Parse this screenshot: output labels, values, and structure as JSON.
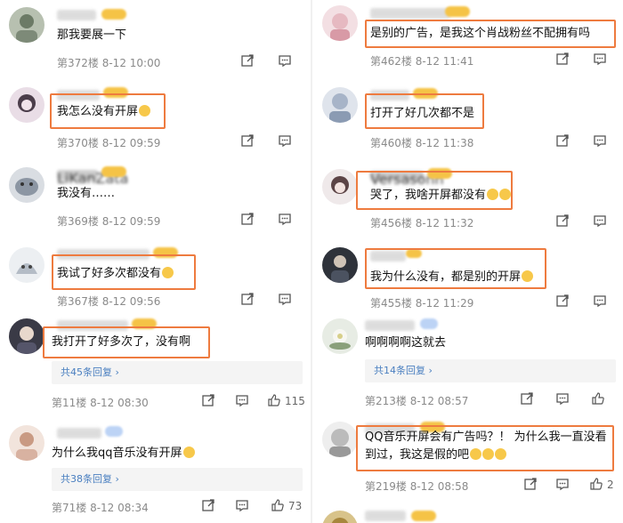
{
  "left": [
    {
      "text": "那我要展一下",
      "meta": "第372楼  8-12 10:00"
    },
    {
      "text": "我怎么没有开屏",
      "meta": "第370楼  8-12 09:59"
    },
    {
      "text": "我没有……",
      "meta": "第369楼  8-12 09:59",
      "name": "LiKanZata"
    },
    {
      "text": "我试了好多次都没有",
      "meta": "第367楼  8-12 09:56"
    },
    {
      "text": "我打开了好多次了，没有啊",
      "reply": "共45条回复 ›",
      "meta": "第11楼  8-12 08:30",
      "likes": "115"
    },
    {
      "text": "为什么我qq音乐没有开屏",
      "reply": "共38条回复 ›",
      "meta": "第71楼  8-12 08:34",
      "likes": "73"
    }
  ],
  "right": [
    {
      "text": "是别的广告，是我这个肖战粉丝不配拥有吗",
      "meta": "第462楼  8-12 11:41"
    },
    {
      "text": "打开了好几次都不是",
      "meta": "第460楼  8-12 11:38"
    },
    {
      "text": "哭了，我啥开屏都没有",
      "meta": "第456楼  8-12 11:32",
      "name": "Versasonn"
    },
    {
      "text": "我为什么没有，都是别的开屏",
      "meta": "第455楼  8-12 11:29"
    },
    {
      "text": "啊啊啊啊这就去",
      "reply": "共14条回复 ›",
      "meta": "第213楼  8-12 08:57"
    },
    {
      "text": "QQ音乐开屏会有广告吗？！ 为什么我一直没看到过，我这是假的吧",
      "meta": "第219楼  8-12 08:58",
      "likes": "2"
    }
  ]
}
